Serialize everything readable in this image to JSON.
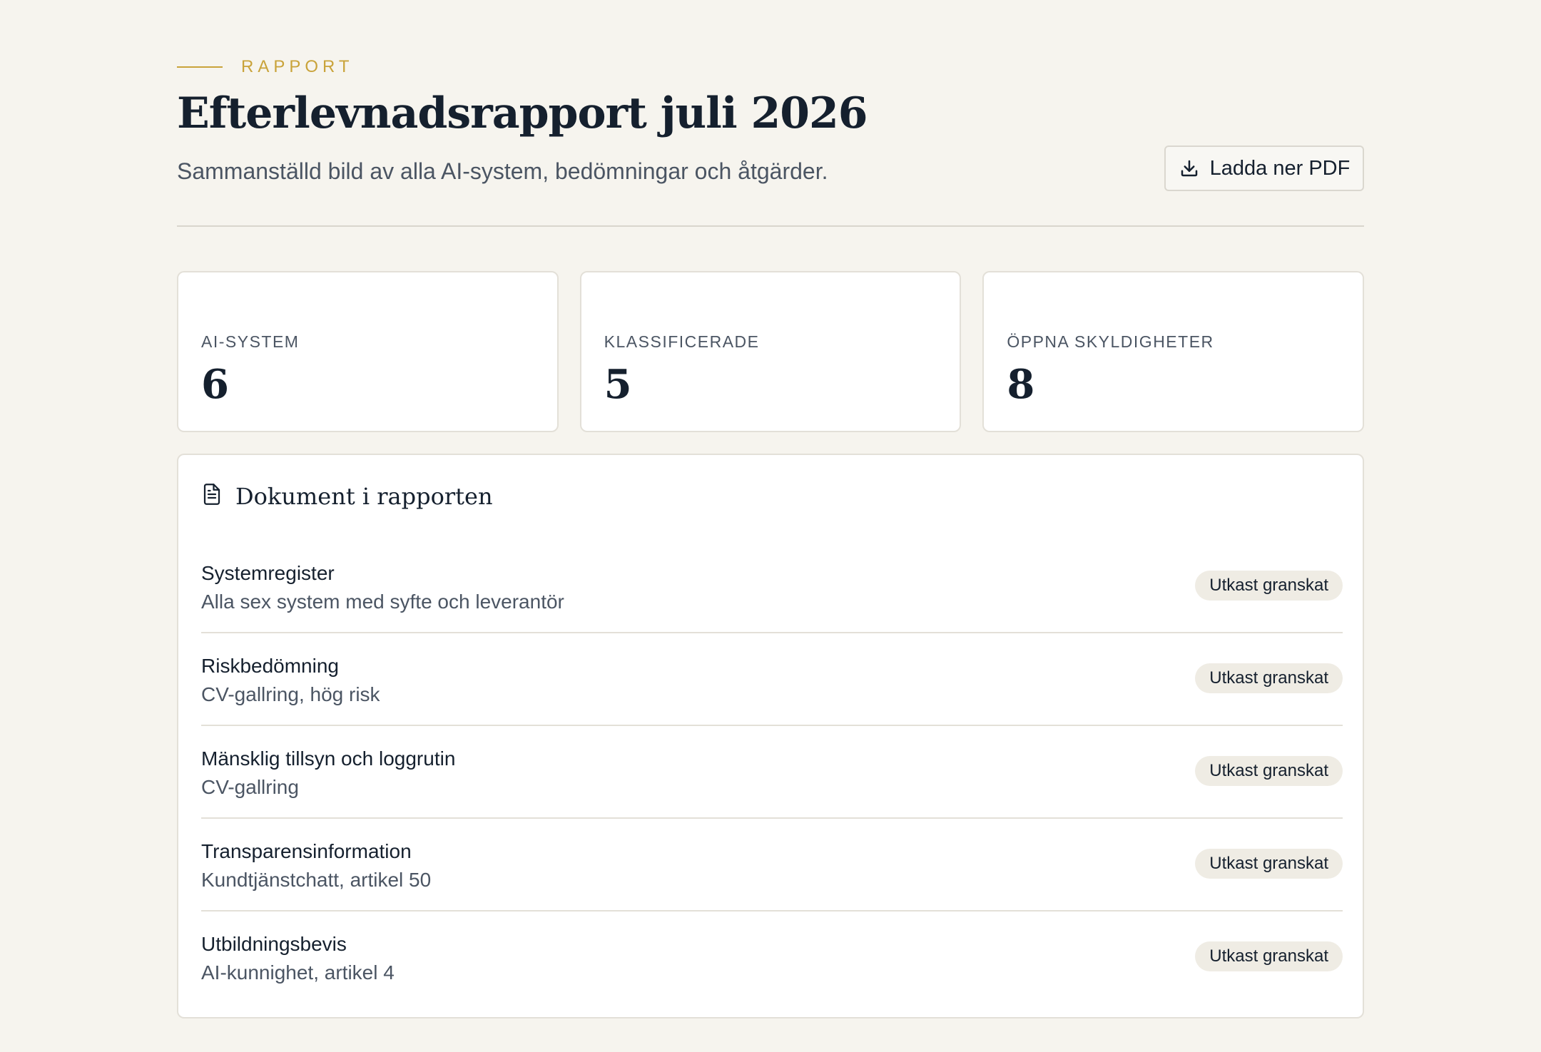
{
  "header": {
    "eyebrow": "RAPPORT",
    "title": "Efterlevnadsrapport juli 2026",
    "subtitle": "Sammanställd bild av alla AI-system, bedömningar och åtgärder.",
    "download_label": "Ladda ner PDF",
    "download_icon": "download-icon"
  },
  "stats": [
    {
      "label": "AI-SYSTEM",
      "value": "6"
    },
    {
      "label": "KLASSIFICERADE",
      "value": "5"
    },
    {
      "label": "ÖPPNA SKYLDIGHETER",
      "value": "8"
    }
  ],
  "documents": {
    "title": "Dokument i rapporten",
    "icon": "document-icon",
    "items": [
      {
        "name": "Systemregister",
        "description": "Alla sex system med syfte och leverantör",
        "status": "Utkast granskat"
      },
      {
        "name": "Riskbedömning",
        "description": "CV-gallring, hög risk",
        "status": "Utkast granskat"
      },
      {
        "name": "Mänsklig tillsyn och loggrutin",
        "description": "CV-gallring",
        "status": "Utkast granskat"
      },
      {
        "name": "Transparensinformation",
        "description": "Kundtjänstchatt, artikel 50",
        "status": "Utkast granskat"
      },
      {
        "name": "Utbildningsbevis",
        "description": "AI-kunnighet, artikel 4",
        "status": "Utkast granskat"
      }
    ]
  },
  "colors": {
    "background": "#f6f4ee",
    "accent": "#c9a33a",
    "text": "#15202e",
    "muted": "#4b5563",
    "badge": "#efece4"
  }
}
